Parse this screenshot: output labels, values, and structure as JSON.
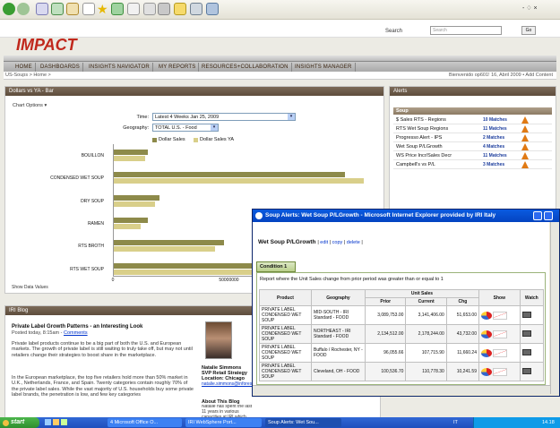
{
  "ie": {
    "search_label": "Search",
    "search_label2": "Search",
    "go_label": "Go",
    "minmax": "- ♢ ×"
  },
  "app": {
    "logo": "IMPACT",
    "crumb": "US-Soups > Home >",
    "welcome": "Bienvenido op601! 16, Abril 2009 • Add Content"
  },
  "nav": [
    "Home",
    "Dashboards",
    "Insights Navigator",
    "My Reports",
    "Resources+Collaboration",
    "Insights Manager"
  ],
  "chart_panel": {
    "title": "Dollars vs YA - Bar",
    "options_label": "Chart Options ▾",
    "time_label": "Time:",
    "time_value": "Latest 4 Weeks Jan 25, 2009",
    "geo_label": "Geography:",
    "geo_value": "TOTAL U.S. - Food",
    "footer": "Show Data Values"
  },
  "chart_data": {
    "type": "bar",
    "orientation": "horizontal",
    "categories": [
      "BOUILLON",
      "CONDENSED WET SOUP",
      "DRY SOUP",
      "RAMEN",
      "RTS BROTH",
      "RTS WET SOUP"
    ],
    "series": [
      {
        "name": "Dollar Sales",
        "values": [
          15000000,
          100000000,
          20000000,
          15000000,
          48000000,
          102000000
        ],
        "color": "#8d8a4a"
      },
      {
        "name": "Dollar Sales YA",
        "values": [
          14000000,
          108000000,
          18000000,
          12000000,
          44000000,
          105000000
        ],
        "color": "#d9cf8a"
      }
    ],
    "xticks": [
      "0",
      "50000000",
      "100000000"
    ],
    "xlim": [
      0,
      112000000
    ]
  },
  "alerts": {
    "title": "Alerts",
    "group": "Soup",
    "items": [
      {
        "name": "$ Sales RTS - Regions",
        "matches": "10 Matches"
      },
      {
        "name": "RTS Wet Soup Regions",
        "matches": "11 Matches"
      },
      {
        "name": "Progresso Alert - IPS",
        "matches": "2 Matches"
      },
      {
        "name": "Wet Soup P/LGrowth",
        "matches": "4 Matches"
      },
      {
        "name": "WS Price Incr/Sales Decr",
        "matches": "11 Matches"
      },
      {
        "name": "Campbell's vs P/L",
        "matches": "3 Matches"
      }
    ]
  },
  "blog": {
    "title": "IRI Blog",
    "post_title": "Private Label Growth Patterns - an Interesting Look",
    "posted": "Posted today, 8:15am - ",
    "comments": "Comments",
    "p1": "Private label products continue to be a big part of both the U.S. and European markets. The growth of private label is still waiting to truly take off, but may not until retailers change their strategies to boost share in the marketplace.",
    "p2": "In the European marketplace, the top five retailers hold more than 50% market in U.K., Netherlands, France, and Spain. Twenty categories contain roughly 70% of the private label sales. While the vast majority of U.S. households buy some private label brands, the penetration is low, and few key categories",
    "author": "Natalie Simmons",
    "author_title": "SVP Retail Strategy",
    "author_loc": "Location: Chicago",
    "author_email": "natalie.simmons@infores.com",
    "about_title": "About This Blog",
    "about_text": "Natalie has spent the last 11 years in various capacities at IRI which include"
  },
  "popup": {
    "window_title": "Soup Alerts: Wet Soup P/LGrowth - Microsoft Internet Explorer provided by IRI Italy",
    "heading": "Wet Soup P/LGrowth",
    "links": [
      "edit",
      "copy",
      "delete"
    ],
    "tab": "Condition 1",
    "condition": "Report where the Unit Sales change from prior period was greater than or equal to 1",
    "cols": {
      "product": "Product",
      "geography": "Geography",
      "unit_sales": "Unit Sales",
      "prior": "Prior",
      "current": "Current",
      "chg": "Chg",
      "show": "Show",
      "watch": "Watch"
    },
    "rows": [
      {
        "product": "PRIVATE LABEL CONDENSED WET SOUP",
        "geography": "MID-SOUTH - IRI Standard - FOOD",
        "prior": "3,089,753.00",
        "current": "3,141,406.00",
        "chg": "51,653.00"
      },
      {
        "product": "PRIVATE LABEL CONDENSED WET SOUP",
        "geography": "NORTHEAST - IRI Standard - FOOD",
        "prior": "2,134,512.00",
        "current": "2,178,244.00",
        "chg": "43,732.00"
      },
      {
        "product": "PRIVATE LABEL CONDENSED WET SOUP",
        "geography": "Buffalo / Rochester, NY - FOOD",
        "prior": "96,055.66",
        "current": "107,715.90",
        "chg": "11,660.24"
      },
      {
        "product": "PRIVATE LABEL CONDENSED WET SOUP",
        "geography": "Cleveland, OH - FOOD",
        "prior": "100,536.70",
        "current": "110,778.30",
        "chg": "10,241.59"
      }
    ]
  },
  "taskbar": {
    "start": "start",
    "tasks": [
      "4 Microsoft Office O...",
      "IRI WebSphere Port...",
      "Soup Alerts: Wet Sou..."
    ],
    "lang": "IT",
    "time": "14.18"
  }
}
